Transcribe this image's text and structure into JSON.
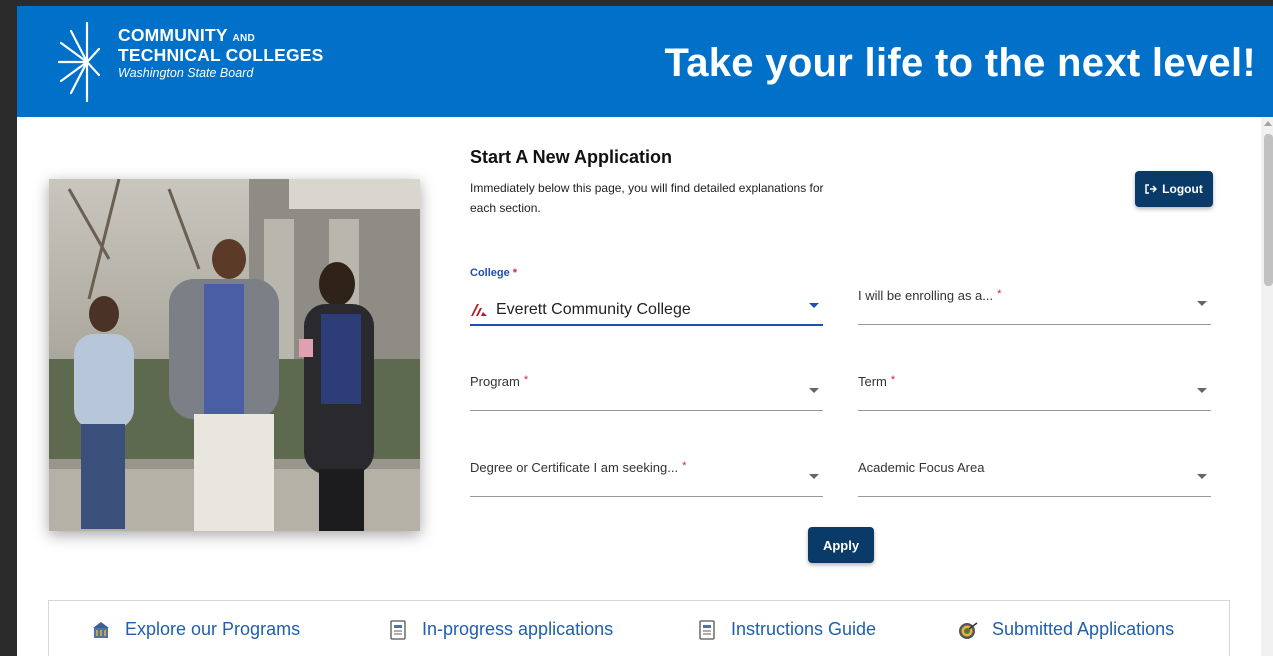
{
  "header": {
    "logo_line1": "COMMUNITY",
    "logo_and": "AND",
    "logo_line2": "TECHNICAL COLLEGES",
    "logo_sub": "Washington State Board",
    "tagline": "Take your life to the next level!"
  },
  "form": {
    "title": "Start A New Application",
    "description": "Immediately below this page, you will find detailed explanations for each section.",
    "logout_label": "Logout",
    "college_label": "College",
    "college_value": "Everett Community College",
    "enrolling_label": "I will be enrolling as a...",
    "program_label": "Program",
    "term_label": "Term",
    "degree_label": "Degree or Certificate I am seeking...",
    "focus_label": "Academic Focus Area",
    "required_mark": "*",
    "apply_label": "Apply"
  },
  "nav": {
    "items": [
      {
        "label": "Explore our Programs",
        "icon": "building-icon"
      },
      {
        "label": "In-progress applications",
        "icon": "document-icon"
      },
      {
        "label": "Instructions Guide",
        "icon": "document-icon"
      },
      {
        "label": "Submitted Applications",
        "icon": "target-icon"
      }
    ]
  },
  "colors": {
    "header_blue": "#0070c9",
    "button_navy": "#0a3a67",
    "link_blue": "#1f5fae",
    "required_red": "#d2233c"
  }
}
